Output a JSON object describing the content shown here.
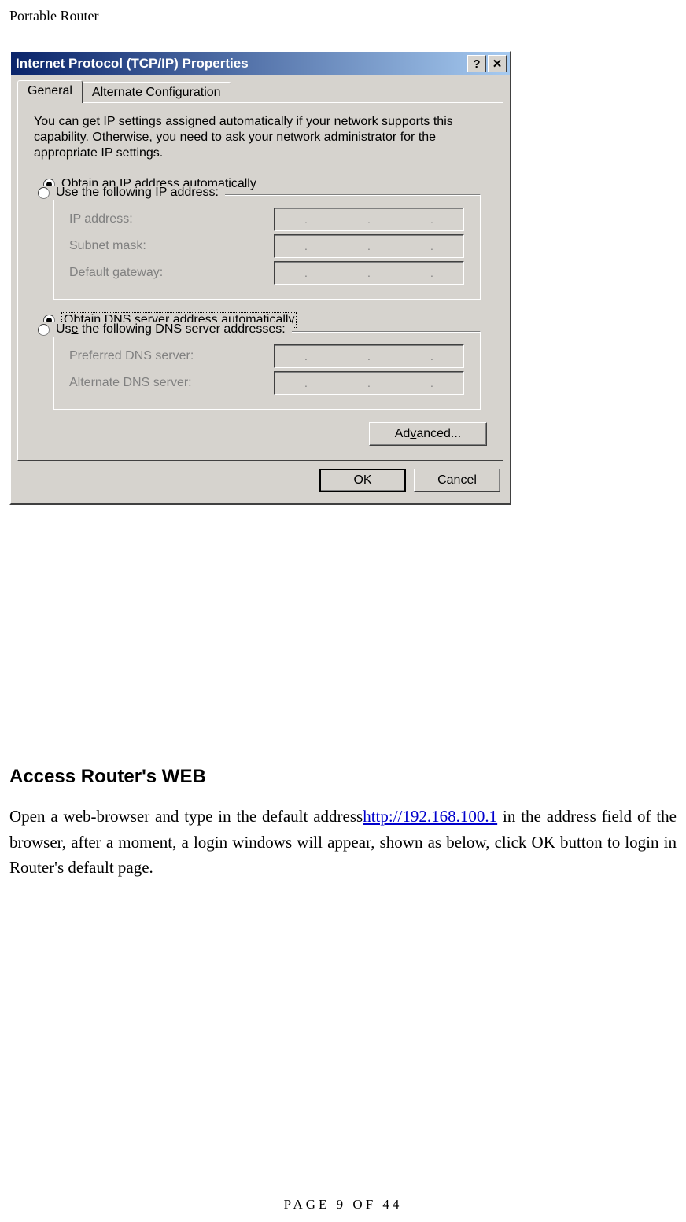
{
  "header": {
    "title": "Portable Router"
  },
  "footer": {
    "prefix": "PAGE",
    "page": "9",
    "of_word": "OF",
    "total": "44"
  },
  "dialog": {
    "title": "Internet Protocol (TCP/IP) Properties",
    "help_glyph": "?",
    "close_glyph": "✕",
    "tabs": {
      "general": "General",
      "alternate": "Alternate Configuration"
    },
    "intro": "You can get IP settings assigned automatically if your network supports this capability. Otherwise, you need to ask your network administrator for the appropriate IP settings.",
    "radios": {
      "obtain_ip_pre": "O",
      "obtain_ip_rest": "btain an IP address automatically",
      "use_ip_pre": "Us",
      "use_ip_u": "e",
      "use_ip_rest": " the following IP address:",
      "obtain_dns_pre": "O",
      "obtain_dns_u": "b",
      "obtain_dns_rest": "tain DNS server address automatically",
      "use_dns_pre": "Us",
      "use_dns_u": "e",
      "use_dns_rest": " the following DNS server addresses:"
    },
    "labels": {
      "ip_address": "IP address:",
      "subnet_mask": "Subnet mask:",
      "default_gateway": "Default gateway:",
      "preferred_dns": "Preferred DNS server:",
      "alternate_dns": "Alternate DNS server:"
    },
    "buttons": {
      "advanced_pre": "Ad",
      "advanced_u": "v",
      "advanced_rest": "anced...",
      "ok": "OK",
      "cancel": "Cancel"
    }
  },
  "section": {
    "heading": "Access Router's WEB",
    "para_before_link": "Open a web-browser and type in the default address",
    "link_text": "http://192.168.100.1",
    "para_after_link": " in the address field of the browser, after a moment, a login windows will appear, shown as below, click OK button to login in Router's default page."
  }
}
